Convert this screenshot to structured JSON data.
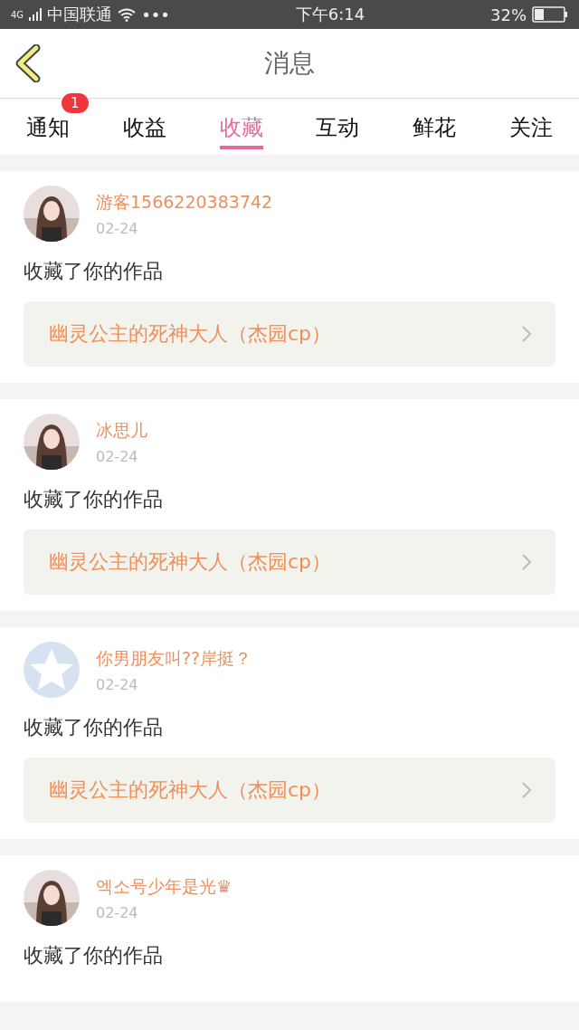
{
  "status_bar": {
    "network": "4G",
    "carrier": "中国联通",
    "more": "•••",
    "time": "下午6:14",
    "battery_text": "32%"
  },
  "header": {
    "title": "消息"
  },
  "tabs": [
    {
      "label": "通知",
      "selected": false,
      "badge": "1"
    },
    {
      "label": "收益",
      "selected": false
    },
    {
      "label": "收藏",
      "selected": true
    },
    {
      "label": "互动",
      "selected": false
    },
    {
      "label": "鲜花",
      "selected": false
    },
    {
      "label": "关注",
      "selected": false
    }
  ],
  "messages": [
    {
      "user": "游客1566220383742",
      "date": "02-24",
      "text": "收藏了你的作品",
      "work": "幽灵公主的死神大人（杰园cp）"
    },
    {
      "user": "冰思儿",
      "date": "02-24",
      "text": "收藏了你的作品",
      "work": "幽灵公主的死神大人（杰园cp）"
    },
    {
      "kind": "default",
      "user": "你男朋友叫??岸挺？",
      "date": "02-24",
      "text": "收藏了你的作品",
      "work": "幽灵公主的死神大人（杰园cp）"
    },
    {
      "user": "엑소号少年是光♛",
      "date": "02-24",
      "text": "收藏了你的作品"
    }
  ]
}
